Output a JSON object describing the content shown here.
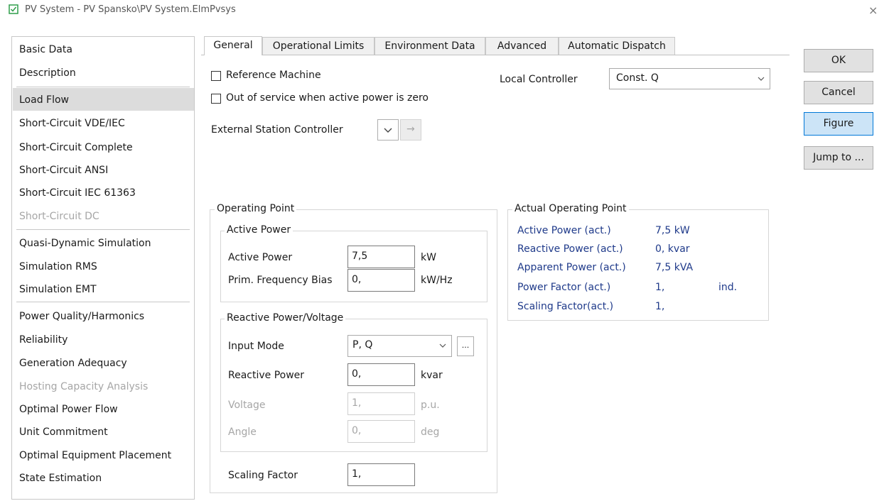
{
  "window": {
    "title": "PV System - PV Spansko\\PV System.ElmPvsys",
    "close_symbol": "×"
  },
  "sidebar": {
    "items": [
      {
        "label": "Basic Data"
      },
      {
        "label": "Description"
      },
      {
        "label": "Load Flow",
        "selected": true
      },
      {
        "label": "Short-Circuit VDE/IEC"
      },
      {
        "label": "Short-Circuit Complete"
      },
      {
        "label": "Short-Circuit ANSI"
      },
      {
        "label": "Short-Circuit IEC 61363"
      },
      {
        "label": "Short-Circuit DC",
        "disabled": true
      },
      {
        "label": "Quasi-Dynamic Simulation"
      },
      {
        "label": "Simulation RMS"
      },
      {
        "label": "Simulation EMT"
      },
      {
        "label": "Power Quality/Harmonics"
      },
      {
        "label": "Reliability"
      },
      {
        "label": "Generation Adequacy"
      },
      {
        "label": "Hosting Capacity Analysis",
        "disabled": true
      },
      {
        "label": "Optimal Power Flow"
      },
      {
        "label": "Unit Commitment"
      },
      {
        "label": "Optimal Equipment Placement"
      },
      {
        "label": "State Estimation"
      }
    ]
  },
  "tabs": [
    {
      "label": "General",
      "active": true
    },
    {
      "label": "Operational Limits"
    },
    {
      "label": "Environment Data"
    },
    {
      "label": "Advanced"
    },
    {
      "label": "Automatic Dispatch"
    }
  ],
  "general": {
    "reference_machine_label": "Reference Machine",
    "reference_machine_checked": false,
    "out_of_service_label": "Out of service when active power is zero",
    "out_of_service_checked": false,
    "local_controller_label": "Local Controller",
    "local_controller_value": "Const. Q",
    "external_station_controller_label": "External Station Controller",
    "jump_arrow": "→"
  },
  "operating_point": {
    "title": "Operating Point",
    "active_power_group": {
      "title": "Active Power",
      "active_power": {
        "label": "Active Power",
        "value": "7,5",
        "unit": "kW"
      },
      "prim_freq_bias": {
        "label": "Prim. Frequency Bias",
        "value": "0,",
        "unit": "kW/Hz"
      }
    },
    "reactive_group": {
      "title": "Reactive Power/Voltage",
      "input_mode": {
        "label": "Input Mode",
        "value": "P, Q",
        "more": "..."
      },
      "reactive_power": {
        "label": "Reactive Power",
        "value": "0,",
        "unit": "kvar"
      },
      "voltage": {
        "label": "Voltage",
        "value": "1,",
        "unit": "p.u."
      },
      "angle": {
        "label": "Angle",
        "value": "0,",
        "unit": "deg"
      }
    },
    "scaling_factor": {
      "label": "Scaling Factor",
      "value": "1,"
    }
  },
  "actual_operating_point": {
    "title": "Actual Operating Point",
    "rows": [
      {
        "label": "Active Power (act.)",
        "value": "7,5 kW",
        "extra": ""
      },
      {
        "label": "Reactive Power (act.)",
        "value": "0, kvar",
        "extra": ""
      },
      {
        "label": "Apparent Power (act.)",
        "value": "7,5 kVA",
        "extra": ""
      },
      {
        "label": "Power Factor (act.)",
        "value": "1,",
        "extra": "ind."
      },
      {
        "label": "Scaling Factor(act.)",
        "value": "1,",
        "extra": ""
      }
    ]
  },
  "buttons": {
    "ok": "OK",
    "cancel": "Cancel",
    "figure": "Figure",
    "jump_to": "Jump to ..."
  },
  "colors": {
    "accent_blue": "#0078d7",
    "value_text_blue": "#1f3a8a",
    "window_icon_green": "#2e9e4a"
  }
}
